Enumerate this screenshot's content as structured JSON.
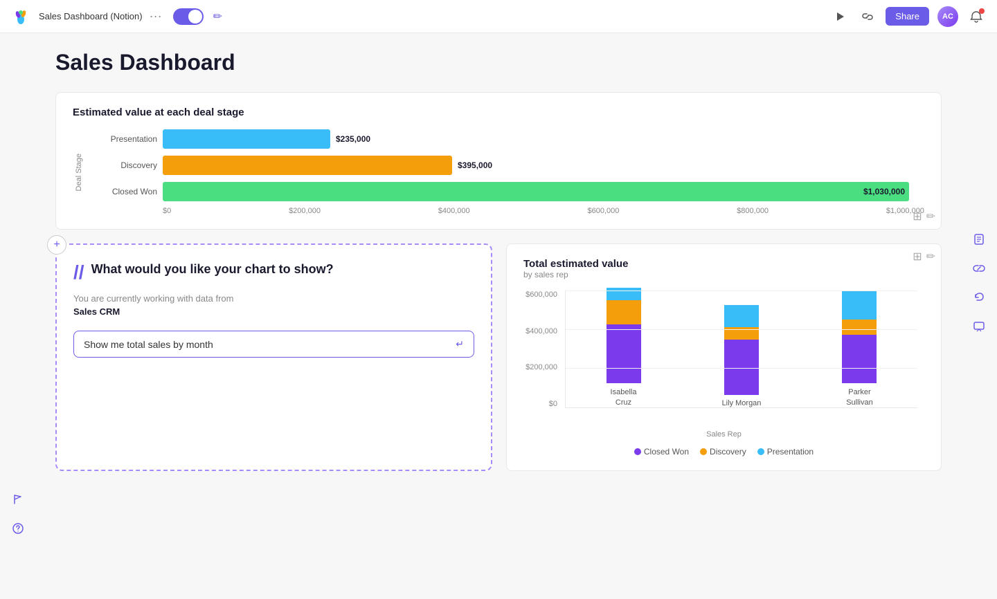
{
  "topbar": {
    "logo_alt": "notion-bird-logo",
    "title": "Sales Dashboard (Notion)",
    "share_label": "Share",
    "toggle_on": true
  },
  "page": {
    "title": "Sales Dashboard"
  },
  "bar_chart": {
    "title": "Estimated value at each deal stage",
    "y_axis_label": "Deal Stage",
    "bars": [
      {
        "label": "Presentation",
        "value": "$235,000",
        "width_pct": 22,
        "color": "#38bdf8"
      },
      {
        "label": "Discovery",
        "value": "$395,000",
        "width_pct": 38,
        "color": "#f59e0b"
      },
      {
        "label": "Closed Won",
        "value": "$1,030,000",
        "width_pct": 100,
        "color": "#4ade80"
      }
    ],
    "x_ticks": [
      "$0",
      "$200,000",
      "$400,000",
      "$600,000",
      "$800,000",
      "$1,000,000"
    ]
  },
  "ai_panel": {
    "slash": "//",
    "question": "What would you like your chart to show?",
    "subtitle": "You are currently working with data from",
    "source": "Sales CRM",
    "input_placeholder": "Show me total sales by month",
    "enter_icon": "↵"
  },
  "stacked_chart": {
    "title": "Total estimated value",
    "subtitle": "by sales rep",
    "y_labels": [
      "$600,000",
      "$400,000",
      "$200,000",
      "$0"
    ],
    "reps": [
      {
        "name": "Isabella\nCruz",
        "closed_won": 58,
        "discovery": 25,
        "presentation": 12
      },
      {
        "name": "Lily Morgan",
        "closed_won": 55,
        "discovery": 12,
        "presentation": 22
      },
      {
        "name": "Parker\nSullivan",
        "closed_won": 48,
        "discovery": 16,
        "presentation": 28
      }
    ],
    "legend": [
      {
        "label": "Closed Won",
        "color": "#7c3aed"
      },
      {
        "label": "Discovery",
        "color": "#f59e0b"
      },
      {
        "label": "Presentation",
        "color": "#38bdf8"
      }
    ],
    "x_axis_label": "Sales Rep"
  },
  "right_sidebar": {
    "icons": [
      "document-icon",
      "link-icon",
      "undo-icon",
      "chat-icon"
    ]
  },
  "left_sidebar": {
    "icons": [
      "flag-icon",
      "help-icon"
    ]
  }
}
